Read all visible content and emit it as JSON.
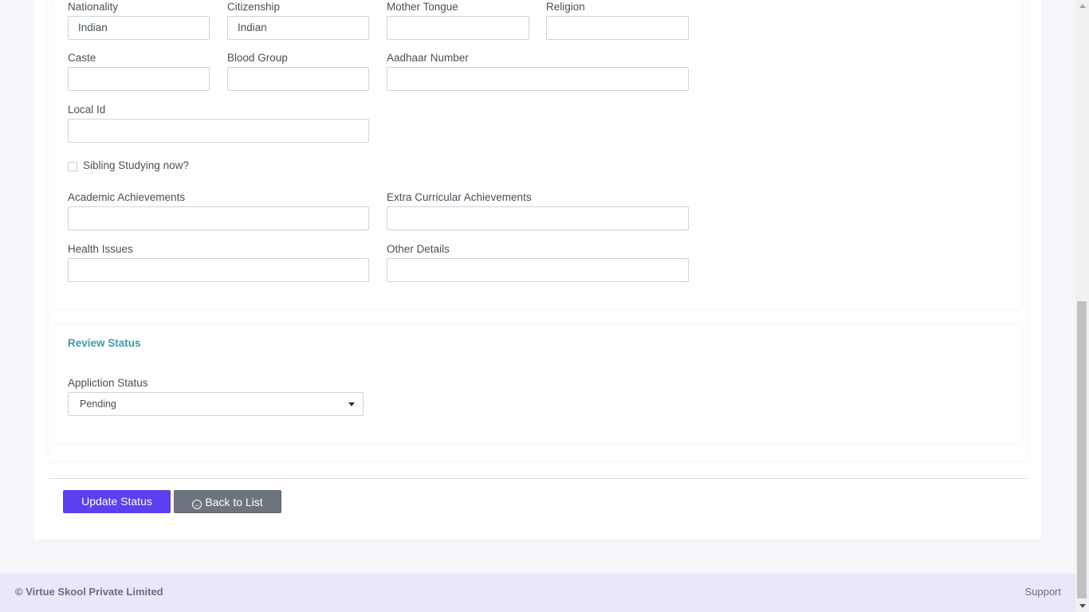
{
  "form": {
    "nationality": {
      "label": "Nationality",
      "value": "Indian"
    },
    "citizenship": {
      "label": "Citizenship",
      "value": "Indian"
    },
    "mother_tongue": {
      "label": "Mother Tongue",
      "value": ""
    },
    "religion": {
      "label": "Religion",
      "value": ""
    },
    "caste": {
      "label": "Caste",
      "value": ""
    },
    "blood_group": {
      "label": "Blood Group",
      "value": ""
    },
    "aadhaar": {
      "label": "Aadhaar Number",
      "value": ""
    },
    "local_id": {
      "label": "Local Id",
      "value": ""
    },
    "sibling": {
      "label": "Sibling Studying now?",
      "checked": false
    },
    "academic": {
      "label": "Academic Achievements",
      "value": ""
    },
    "extra": {
      "label": "Extra Curricular Achievements",
      "value": ""
    },
    "health": {
      "label": "Health Issues",
      "value": ""
    },
    "other": {
      "label": "Other Details",
      "value": ""
    }
  },
  "review": {
    "title": "Review Status",
    "status_label": "Appliction Status",
    "status_value": "Pending"
  },
  "actions": {
    "update_label": "Update Status",
    "back_label": "Back to List",
    "back_icon": "circle-arrow-left-icon"
  },
  "footer": {
    "copyright": "© Virtue Skool Private Limited",
    "support": "Support"
  },
  "colors": {
    "primary": "#5b3ff0",
    "secondary": "#6c757d",
    "accent": "#3a9bb0",
    "footer_bg": "#eae6fb"
  }
}
